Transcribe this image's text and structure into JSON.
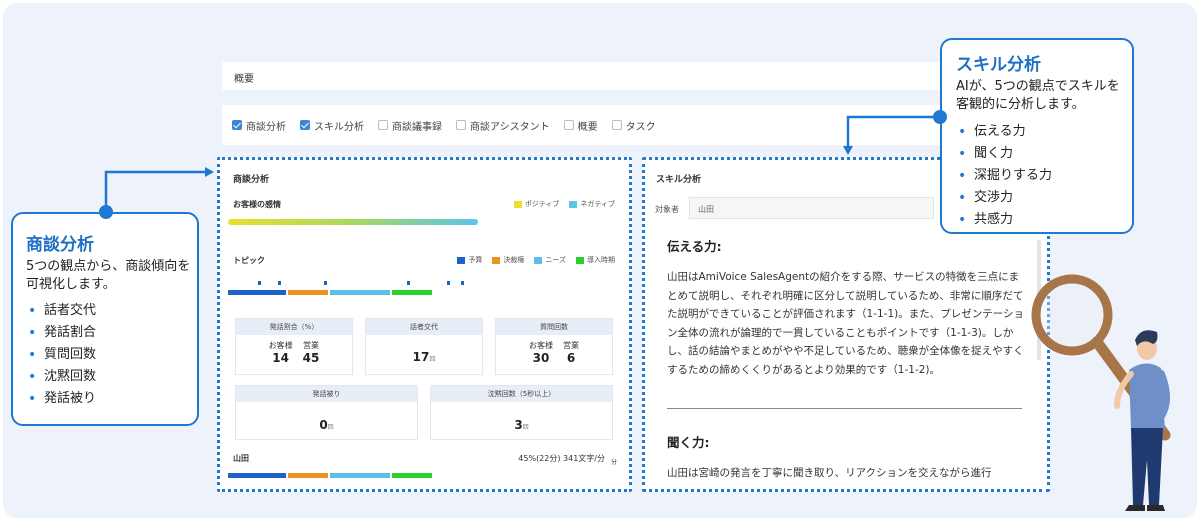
{
  "overview_bar": {
    "label": "概要"
  },
  "tabs": [
    {
      "label": "商談分析",
      "checked": true
    },
    {
      "label": "スキル分析",
      "checked": true
    },
    {
      "label": "商談議事録",
      "checked": false
    },
    {
      "label": "商談アシスタント",
      "checked": false
    },
    {
      "label": "概要",
      "checked": false
    },
    {
      "label": "タスク",
      "checked": false
    }
  ],
  "analysis": {
    "title": "商談分析",
    "sentiment": {
      "label": "お客様の感情",
      "positive": "ポジティブ",
      "negative": "ネガティブ",
      "positive_color": "#e8e030",
      "negative_color": "#5bc4e8"
    },
    "topic": {
      "label": "トピック",
      "legend": [
        {
          "label": "予算",
          "color": "#1e64c8"
        },
        {
          "label": "決裁権",
          "color": "#f0901e"
        },
        {
          "label": "ニーズ",
          "color": "#5bc0e8"
        },
        {
          "label": "導入時期",
          "color": "#28d228"
        }
      ]
    },
    "stats": {
      "ratio": {
        "label": "発話割合（%）",
        "customer_label": "お客様",
        "sales_label": "営業",
        "customer_value": "14",
        "sales_value": "45"
      },
      "turns": {
        "label": "話者交代",
        "value": "17",
        "unit": "回"
      },
      "questions": {
        "label": "質問回数",
        "customer_label": "お客様",
        "sales_label": "営業",
        "customer_value": "30",
        "sales_value": "6"
      },
      "interrupt": {
        "label": "発話被り",
        "value": "0",
        "unit": "回"
      },
      "silence": {
        "label": "沈黙回数（5秒以上）",
        "value": "3",
        "unit": "回"
      }
    },
    "speaker": {
      "name": "山田",
      "summary": "45%(22分) 341文字/分",
      "unit": "分"
    }
  },
  "skill": {
    "title": "スキル分析",
    "target_label": "対象者",
    "target_value": "山田",
    "sections": [
      {
        "heading": "伝える力:",
        "body": "山田はAmiVoice SalesAgentの紹介をする際、サービスの特徴を三点にまとめて説明し、それぞれ明確に区分して説明しているため、非常に順序だてた説明ができていることが評価されます（1-1-1)。また、プレゼンテーション全体の流れが論理的で一貫していることもポイントです（1-1-3)。しかし、話の結論やまとめがやや不足しているため、聴衆が全体像を捉えやすくするための締めくくりがあるとより効果的です（1-1-2)。"
      },
      {
        "heading": "聞く力:",
        "body": "山田は宮崎の発言を丁寧に聞き取り、リアクションを交えながら進行"
      }
    ]
  },
  "callout_left": {
    "title": "商談分析",
    "desc": "5つの観点から、商談傾向を可視化します。",
    "items": [
      "話者交代",
      "発話割合",
      "質問回数",
      "沈黙回数",
      "発話被り"
    ]
  },
  "callout_right": {
    "title": "スキル分析",
    "desc": "AIが、5つの観点でスキルを客観的に分析します。",
    "items": [
      "伝える力",
      "聞く力",
      "深掘りする力",
      "交渉力",
      "共感力"
    ]
  },
  "colors": {
    "accent": "#1f78d1",
    "panel": "#eef2fa"
  }
}
